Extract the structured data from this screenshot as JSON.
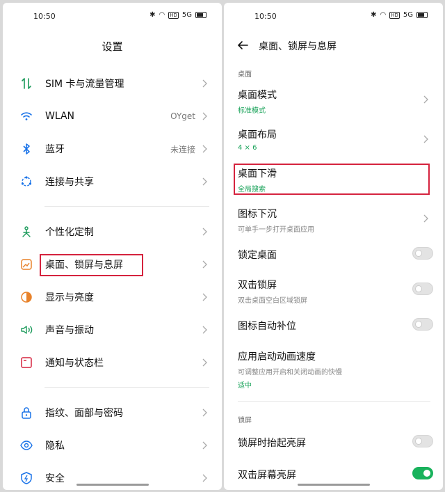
{
  "left": {
    "status": {
      "time": "10:50",
      "signal": "5G",
      "hd": "HD"
    },
    "title": "设置",
    "items": [
      {
        "label": "SIM 卡与流量管理",
        "value": ""
      },
      {
        "label": "WLAN",
        "value": "OYget"
      },
      {
        "label": "蓝牙",
        "value": "未连接"
      },
      {
        "label": "连接与共享",
        "value": ""
      },
      {
        "label": "个性化定制",
        "value": ""
      },
      {
        "label": "桌面、锁屏与息屏",
        "value": ""
      },
      {
        "label": "显示与亮度",
        "value": ""
      },
      {
        "label": "声音与振动",
        "value": ""
      },
      {
        "label": "通知与状态栏",
        "value": ""
      },
      {
        "label": "指纹、面部与密码",
        "value": ""
      },
      {
        "label": "隐私",
        "value": ""
      },
      {
        "label": "安全",
        "value": ""
      }
    ]
  },
  "right": {
    "status": {
      "time": "10:50",
      "signal": "5G",
      "hd": "HD"
    },
    "title": "桌面、锁屏与息屏",
    "section_desktop": "桌面",
    "section_lock": "锁屏",
    "items": [
      {
        "title": "桌面模式",
        "sub": "标准模式"
      },
      {
        "title": "桌面布局",
        "sub": "4 × 6"
      },
      {
        "title": "桌面下滑",
        "sub": "全局搜索"
      },
      {
        "title": "图标下沉",
        "sub": "可单手一步打开桌面应用"
      },
      {
        "title": "锁定桌面",
        "toggle": false
      },
      {
        "title": "双击锁屏",
        "sub": "双击桌面空白区域锁屏",
        "toggle": false
      },
      {
        "title": "图标自动补位",
        "toggle": false
      },
      {
        "title": "应用启动动画速度",
        "sub": "可调整应用开启和关闭动画的快慢",
        "extra": "适中"
      },
      {
        "title": "锁屏时抬起亮屏",
        "toggle": false
      },
      {
        "title": "双击屏幕亮屏",
        "toggle": true
      }
    ]
  },
  "colors": {
    "accent": "#1a73e8",
    "green": "#19b25c",
    "highlight": "#d5233e"
  }
}
